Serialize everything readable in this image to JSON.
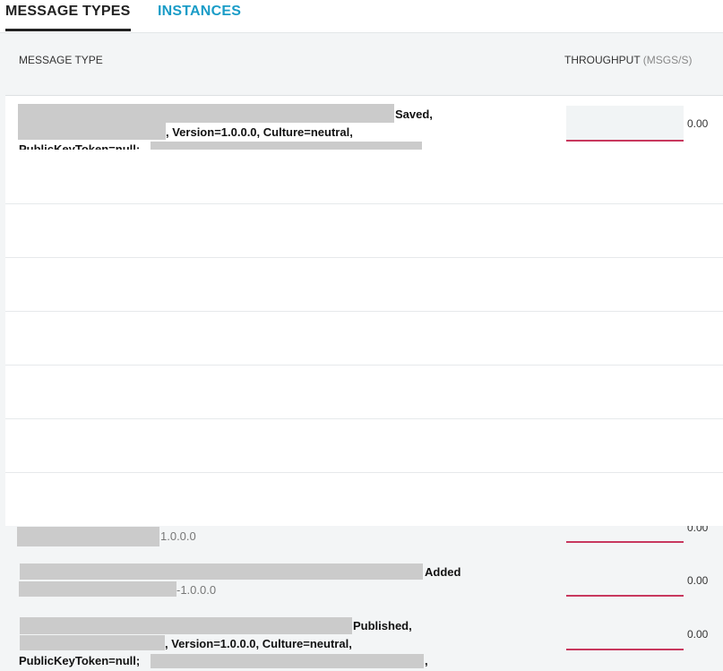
{
  "tabs": [
    {
      "label": "MESSAGE TYPES",
      "active": true
    },
    {
      "label": "INSTANCES",
      "active": false
    }
  ],
  "columns": {
    "message_type": "MESSAGE TYPE",
    "throughput": "THROUGHPUT",
    "throughput_unit": "(MSGS/S)"
  },
  "rows": [
    {
      "line1": "Saved,",
      "line2": ", Version=1.0.0.0, Culture=neutral,",
      "line3": "PublicKeyToken=null;",
      "throughput": "0.00"
    },
    {
      "line2": "1.0.0.0",
      "throughput": "0.00"
    },
    {
      "line1": "Added",
      "line2": "-1.0.0.0",
      "throughput": "0.00"
    },
    {
      "line1": "Published,",
      "line2": ", Version=1.0.0.0, Culture=neutral,",
      "line3": "PublicKeyToken=null;",
      "line3_suffix": ",",
      "throughput": "0.00"
    }
  ],
  "colors": {
    "accent_tab": "#1a9cc7",
    "underline_active": "#222222",
    "throughput_underline": "#c8385e"
  }
}
